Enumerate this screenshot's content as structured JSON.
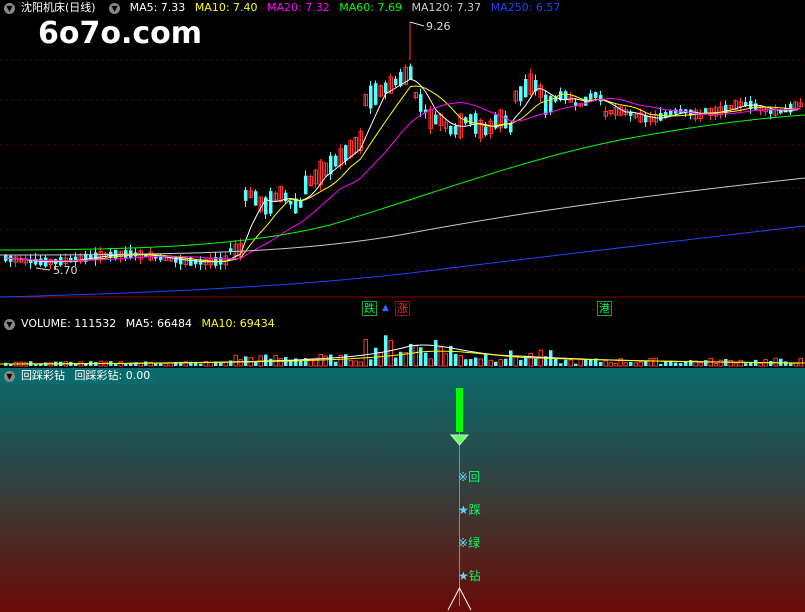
{
  "main": {
    "title": "沈阳机床(日线)",
    "ma": [
      {
        "label": "MA5: 7.33",
        "color": "#ffffff"
      },
      {
        "label": "MA10: 7.40",
        "color": "#ffff00"
      },
      {
        "label": "MA20: 7.32",
        "color": "#ff00ff"
      },
      {
        "label": "MA60: 7.69",
        "color": "#00ff00"
      },
      {
        "label": "MA120: 7.37",
        "color": "#cccccc"
      },
      {
        "label": "MA250: 6.57",
        "color": "#2244ff"
      }
    ],
    "high_label": "9.26",
    "low_label": "5.70",
    "tags": [
      {
        "text": "跌",
        "color": "#00ff44"
      },
      {
        "text": "涨",
        "color": "#ff3333"
      },
      {
        "text": "港",
        "color": "#00ff44"
      }
    ]
  },
  "volume": {
    "title": "VOLUME: 111532",
    "ma5": "MA5: 66484",
    "ma10": "MA10: 69434"
  },
  "indicator": {
    "title": "回踩彩钻",
    "value": "回踩彩钻: 0.00",
    "markers": [
      {
        "sym": "※",
        "text": "回"
      },
      {
        "sym": "★",
        "text": "踩"
      },
      {
        "sym": "※",
        "text": "绿"
      },
      {
        "sym": "★",
        "text": "钻"
      }
    ]
  },
  "watermark": "6o7o.com",
  "colors": {
    "up": "#ff3333",
    "down": "#54ffff",
    "ma5": "#ffffff",
    "ma10": "#ffff00",
    "ma20": "#ff00ff",
    "ma60": "#00ff00",
    "ma120": "#cccccc",
    "ma250": "#2244ff",
    "signal": "#00ff00"
  }
}
